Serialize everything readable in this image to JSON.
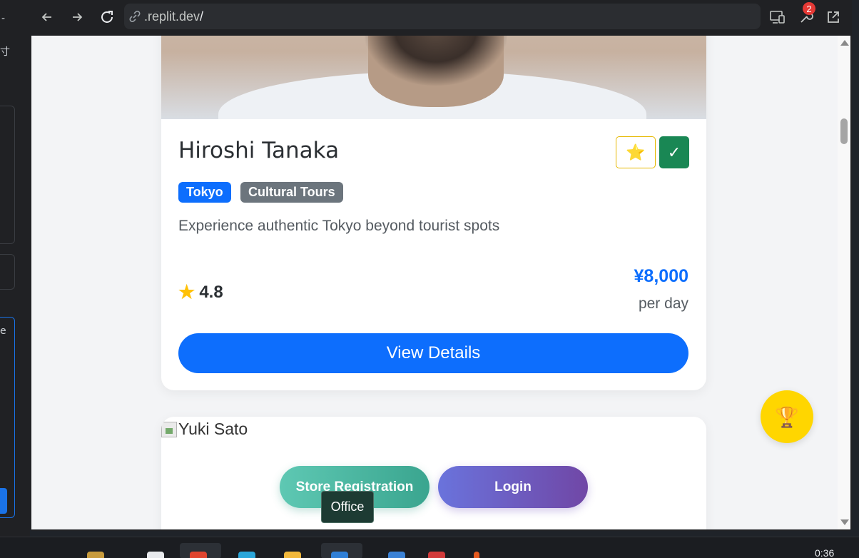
{
  "browser": {
    "url_prefix": ".replit.dev",
    "url_suffix": "/",
    "notification_count": "2"
  },
  "guide_card": {
    "name": "Hiroshi Tanaka",
    "city_tag": "Tokyo",
    "category_tag": "Cultural Tours",
    "description": "Experience authentic Tokyo beyond tourist spots",
    "rating": "4.8",
    "price": "¥8,000",
    "price_unit": "per day",
    "view_details_label": "View Details",
    "favorite_icon": "⭐",
    "check_icon": "✓"
  },
  "next_card": {
    "image_alt": "Yuki Sato"
  },
  "actions": {
    "store_registration_label": "Store Registration",
    "login_label": "Login",
    "trophy_icon": "🏆"
  },
  "tooltip": {
    "text": "Office"
  },
  "taskbar": {
    "time": "0:36"
  },
  "colors": {
    "primary": "#0d6efd",
    "success": "#198754",
    "secondary": "#6c757d",
    "trophy": "#ffd600"
  }
}
